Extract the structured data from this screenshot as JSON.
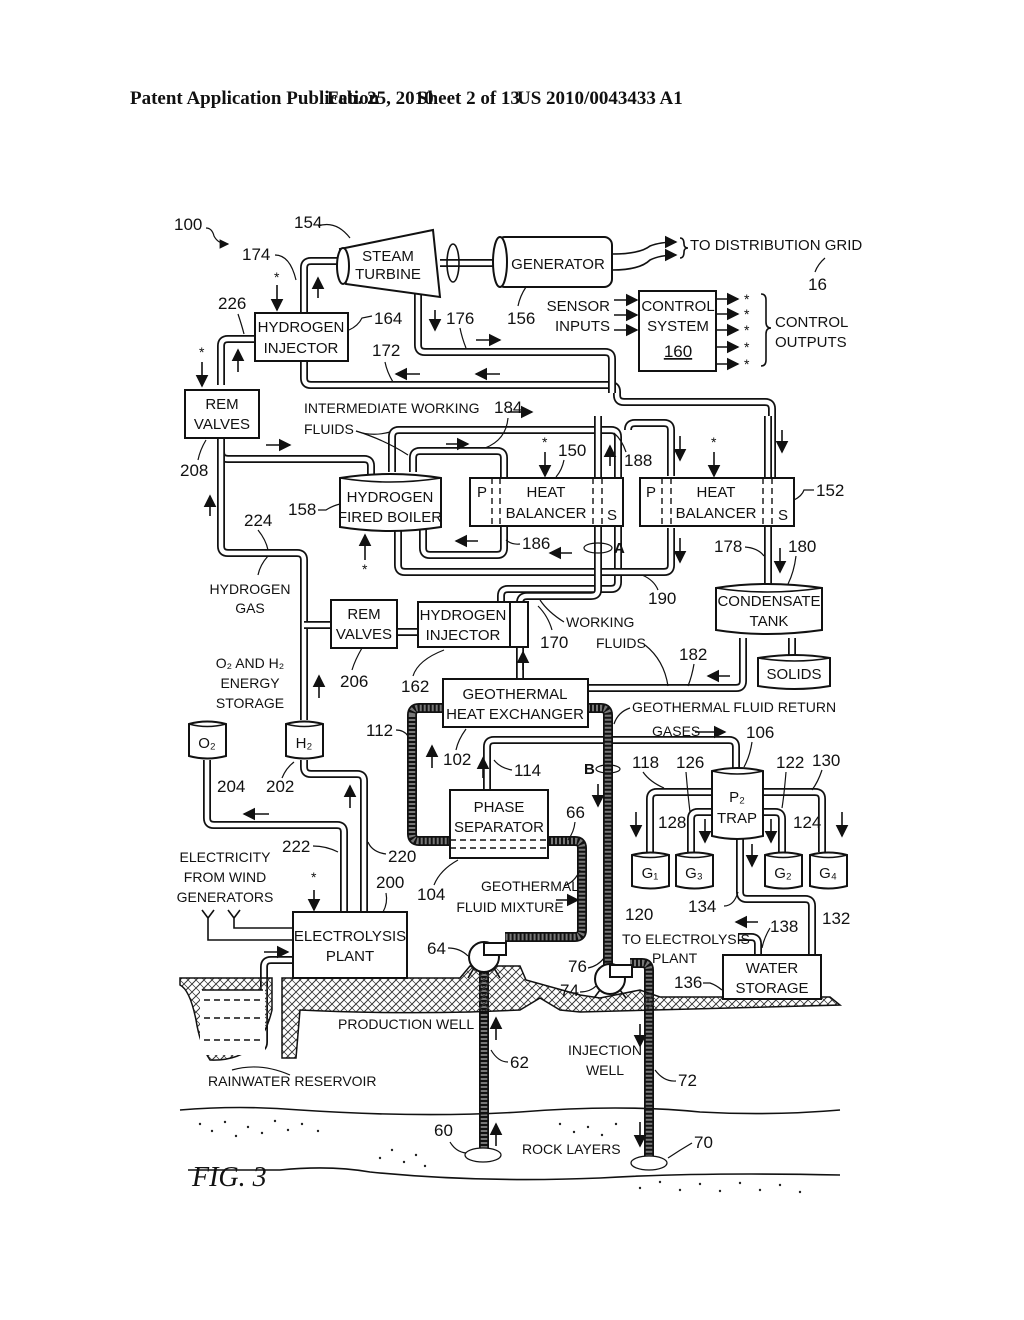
{
  "header": {
    "publication": "Patent Application Publication",
    "date": "Feb. 25, 2010",
    "sheet": "Sheet 2 of 13",
    "number": "US 2010/0043433 A1"
  },
  "figure": {
    "label": "FIG. 3",
    "system_ref": "100"
  },
  "components": {
    "steam_turbine": {
      "line1": "STEAM",
      "line2": "TURBINE",
      "ref": "154"
    },
    "generator": {
      "label": "GENERATOR",
      "ref": "156"
    },
    "distribution": {
      "label": "TO DISTRIBUTION GRID",
      "ref": "16"
    },
    "control_system": {
      "line1": "CONTROL",
      "line2": "SYSTEM",
      "ref": "160"
    },
    "sensor_inputs": {
      "line1": "SENSOR",
      "line2": "INPUTS"
    },
    "control_outputs": {
      "line1": "CONTROL",
      "line2": "OUTPUTS"
    },
    "hydrogen_injector_top": {
      "line1": "HYDROGEN",
      "line2": "INJECTOR",
      "ref": "164"
    },
    "rem_valves_top": {
      "line1": "REM",
      "line2": "VALVES",
      "ref": "208"
    },
    "intermediate_fluids": {
      "line1": "INTERMEDIATE WORKING",
      "line2": "FLUIDS"
    },
    "boiler": {
      "line1": "HYDROGEN",
      "line2": "FIRED BOILER",
      "ref": "158"
    },
    "heat_balancer_1": {
      "p": "P",
      "line1": "HEAT",
      "line2": "BALANCER",
      "s": "S",
      "ref": "150"
    },
    "heat_balancer_2": {
      "p": "P",
      "line1": "HEAT",
      "line2": "BALANCER",
      "s": "S",
      "ref": "152"
    },
    "condensate_tank": {
      "line1": "CONDENSATE",
      "line2": "TANK"
    },
    "solids": {
      "label": "SOLIDS"
    },
    "hydrogen_gas": {
      "line1": "HYDROGEN",
      "line2": "GAS",
      "ref": "224"
    },
    "rem_valves_mid": {
      "line1": "REM",
      "line2": "VALVES",
      "ref": "206"
    },
    "hydrogen_injector_mid": {
      "line1": "HYDROGEN",
      "line2": "INJECTOR",
      "ref": "162"
    },
    "working_fluids": {
      "line1": "WORKING",
      "line2": "FLUIDS"
    },
    "energy_storage": {
      "line1": "O₂ AND H₂",
      "line2": "ENERGY",
      "line3": "STORAGE"
    },
    "o2_tank": {
      "label": "O₂",
      "ref": "204"
    },
    "h2_tank": {
      "label": "H₂",
      "ref": "202"
    },
    "geo_heat_exchanger": {
      "line1": "GEOTHERMAL",
      "line2": "HEAT EXCHANGER",
      "ref": "102"
    },
    "geo_return": {
      "label": "GEOTHERMAL FLUID RETURN"
    },
    "gases": {
      "label": "GASES"
    },
    "phase_separator": {
      "line1": "PHASE",
      "line2": "SEPARATOR",
      "ref": "104"
    },
    "geo_mixture": {
      "line1": "GEOTHERMAL",
      "line2": "FLUID MIXTURE"
    },
    "p2_trap": {
      "line1": "P₂",
      "line2": "TRAP",
      "ref": "106"
    },
    "g1": {
      "label": "G₁",
      "ref": "120"
    },
    "g3": {
      "label": "G₃",
      "ref": "128"
    },
    "g2": {
      "label": "G₂",
      "ref": "124"
    },
    "g4": {
      "label": "G₄",
      "ref": "132"
    },
    "electricity": {
      "line1": "ELECTRICITY",
      "line2": "FROM WIND",
      "line3": "GENERATORS"
    },
    "electrolysis_plant": {
      "line1": "ELECTROLYSIS",
      "line2": "PLANT",
      "ref": "200"
    },
    "to_electrolysis": {
      "line1": "TO ELECTROLYSIS",
      "line2": "PLANT"
    },
    "water_storage": {
      "line1": "WATER",
      "line2": "STORAGE",
      "ref": "136"
    },
    "production_well": {
      "label": "PRODUCTION WELL",
      "ref": "62"
    },
    "injection_well": {
      "line1": "INJECTION",
      "line2": "WELL",
      "ref": "72"
    },
    "rainwater": {
      "label": "RAINWATER RESERVOIR"
    },
    "rock_layers": {
      "label": "ROCK LAYERS"
    }
  },
  "refs": {
    "r174": "174",
    "r226": "226",
    "r176": "176",
    "r172": "172",
    "r184": "184",
    "r188": "188",
    "r186": "186",
    "r190": "190",
    "r178": "178",
    "r180": "180",
    "r182": "182",
    "r170": "170",
    "r112": "112",
    "r114": "114",
    "r118": "118",
    "r126": "126",
    "r122": "122",
    "r130": "130",
    "r134": "134",
    "r138": "138",
    "r66": "66",
    "r64": "64",
    "r76": "76",
    "r74": "74",
    "r222": "222",
    "r220": "220",
    "r60": "60",
    "r70": "70",
    "markA": "A",
    "markB": "B",
    "star": "*"
  }
}
